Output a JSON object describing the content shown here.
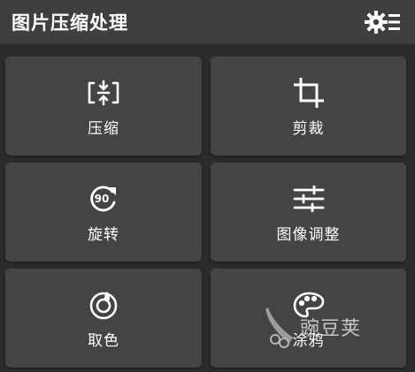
{
  "header": {
    "title": "图片压缩处理",
    "settings_icon": "gear-with-list-icon"
  },
  "tiles": [
    {
      "label": "压缩",
      "icon": "compress-icon"
    },
    {
      "label": "剪裁",
      "icon": "crop-icon"
    },
    {
      "label": "旋转",
      "icon": "rotate-90-icon"
    },
    {
      "label": "图像调整",
      "icon": "sliders-icon"
    },
    {
      "label": "取色",
      "icon": "color-picker-icon"
    },
    {
      "label": "涂鸦",
      "icon": "palette-icon"
    }
  ],
  "watermark": {
    "text": "豌豆荚",
    "icon": "pea-pod-logo"
  },
  "colors": {
    "background": "#2b2b2b",
    "header": "#3f3f3f",
    "tile": "#444444",
    "foreground": "#ffffff"
  }
}
